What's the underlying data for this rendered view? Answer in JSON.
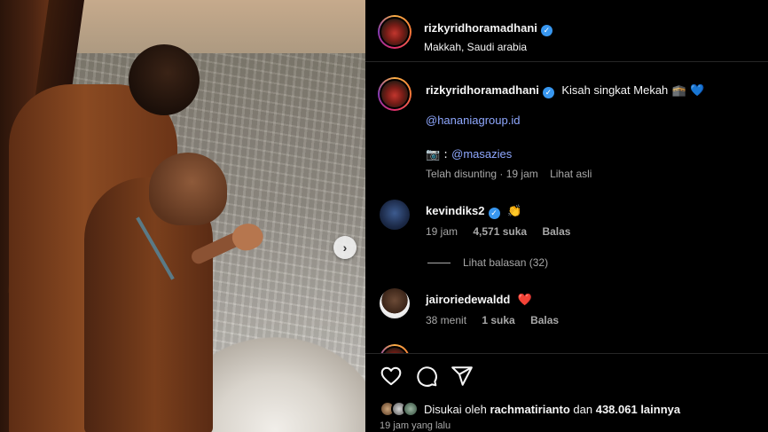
{
  "post": {
    "author": "rizkyridhoramadhani",
    "location": "Makkah, Saudi arabia"
  },
  "caption": {
    "author": "rizkyridhoramadhani",
    "text": "Kisah singkat Mekah",
    "emoji": "🕋 💙",
    "mention1": "@hananiagroup.id",
    "camera_prefix": "📷 :",
    "mention2": "@masazies",
    "edited": "Telah disunting · 19 jam",
    "see_original": "Lihat asli"
  },
  "comments": [
    {
      "user": "kevindiks2",
      "emoji": "👏",
      "time": "19 jam",
      "likes": "4,571 suka",
      "reply": "Balas",
      "view_replies": "Lihat balasan (32)"
    },
    {
      "user": "jairoriedewaldd",
      "emoji": "❤️",
      "time": "38 menit",
      "likes": "1 suka",
      "reply": "Balas"
    }
  ],
  "likes_text_prefix": "Disukai oleh",
  "likes_user": "rachmatirianto",
  "likes_text_mid": "dan",
  "likes_count": "438.061 lainnya",
  "posted_ago": "19 jam yang lalu",
  "icons": {
    "like": "heart-icon",
    "comment": "comment-icon",
    "share": "share-icon",
    "next": "chevron-right-icon",
    "verified": "verified-badge-icon"
  },
  "colors": {
    "background": "#000000",
    "link": "#8fa8ff",
    "verified": "#3897f0",
    "muted": "#a8a8a8",
    "heart": "#ed4956"
  }
}
